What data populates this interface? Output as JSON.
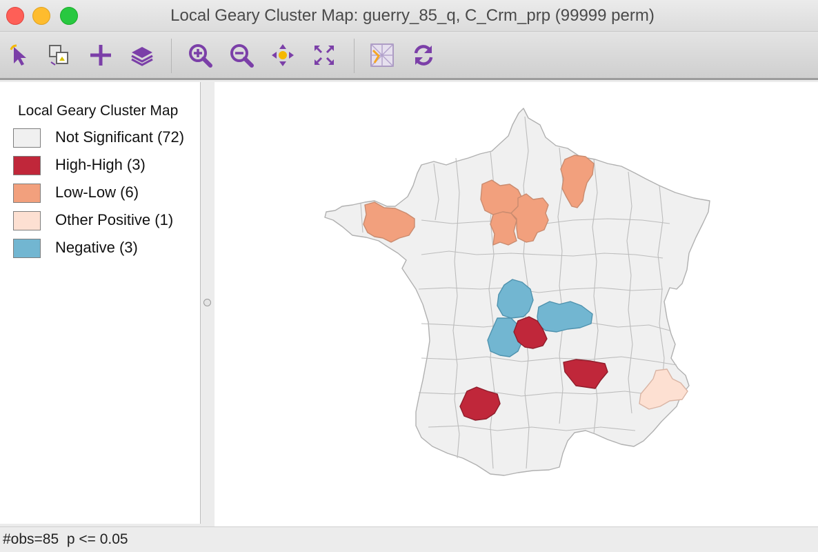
{
  "window": {
    "title": "Local Geary Cluster Map: guerry_85_q, C_Crm_prp (99999 perm)"
  },
  "toolbar": {
    "icons": [
      "select-arrow-icon",
      "copy-image-icon",
      "add-plus-icon",
      "layers-icon",
      "zoom-in-icon",
      "zoom-out-icon",
      "pan-icon",
      "fit-extent-icon",
      "basemap-icon",
      "refresh-icon"
    ],
    "icon_color": "#7b3fa8"
  },
  "legend": {
    "title": "Local Geary Cluster Map",
    "items": [
      {
        "label": "Not Significant (72)",
        "color": "#f0f0f0"
      },
      {
        "label": "High-High (3)",
        "color": "#c0273a"
      },
      {
        "label": "Low-Low (6)",
        "color": "#f2a07d"
      },
      {
        "label": "Other Positive (1)",
        "color": "#fde0d2"
      },
      {
        "label": "Negative (3)",
        "color": "#72b6d1"
      }
    ]
  },
  "map": {
    "region_border_color": "#b0b0b0"
  },
  "status": {
    "text": "#obs=85  p <= 0.05"
  }
}
